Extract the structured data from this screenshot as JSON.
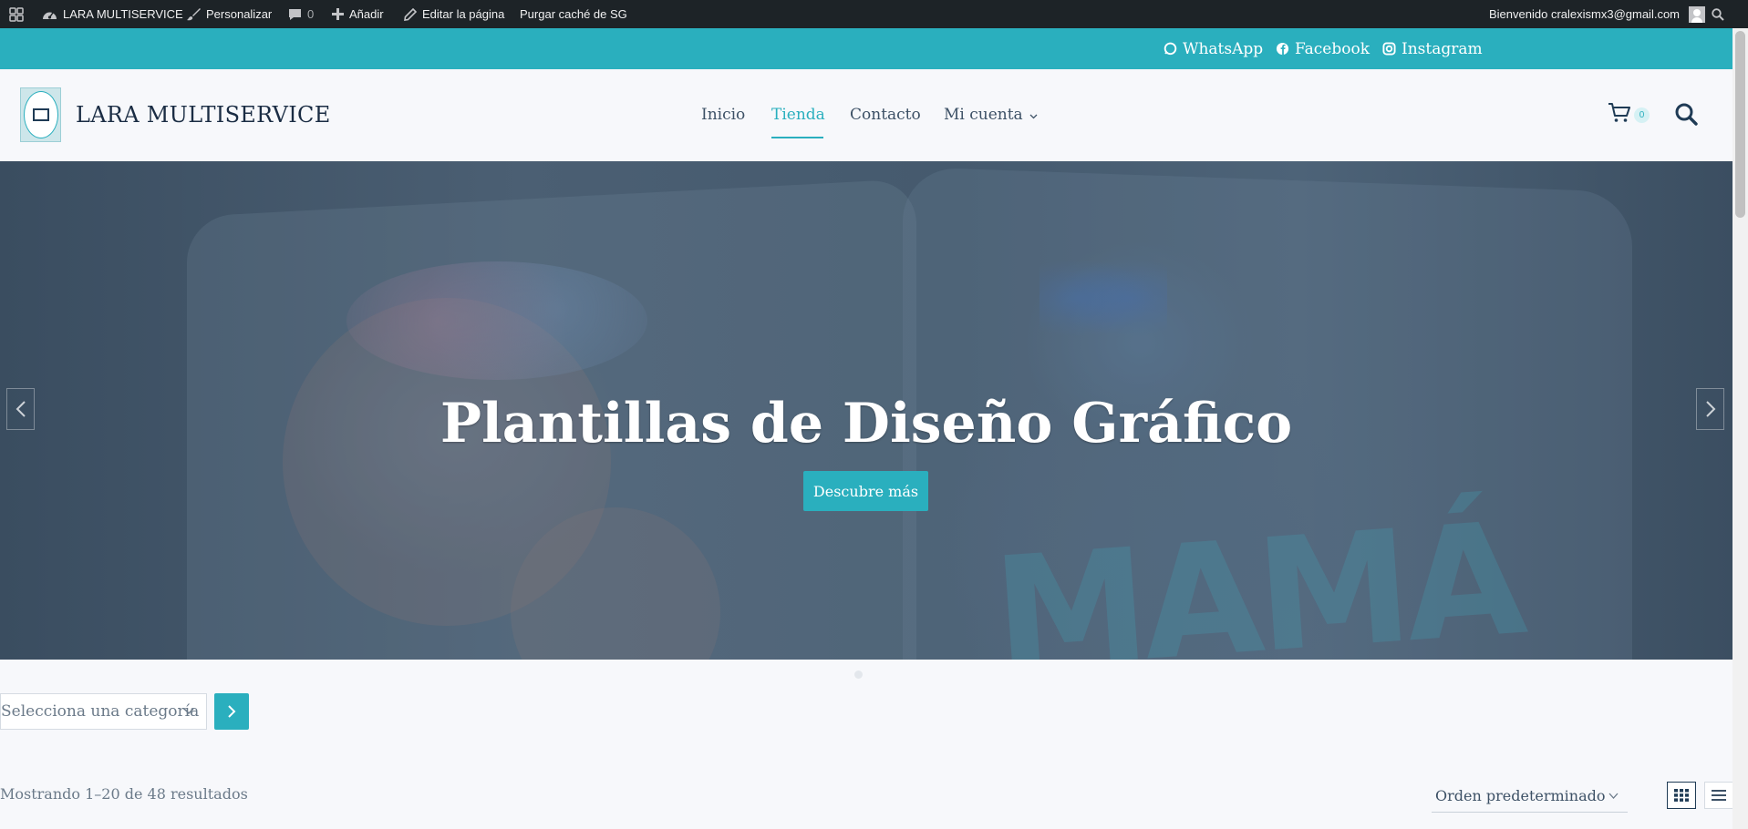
{
  "admin_bar": {
    "site_name": "LARA MULTISERVICE",
    "customize": "Personalizar",
    "comments_count": "0",
    "add_new": "Añadir",
    "edit_page": "Editar la página",
    "purge_cache": "Purgar caché de SG",
    "welcome": "Bienvenido cralexismx3@gmail.com"
  },
  "social": [
    {
      "label": "WhatsApp",
      "icon": "whatsapp-icon"
    },
    {
      "label": "Facebook",
      "icon": "facebook-icon"
    },
    {
      "label": "Instagram",
      "icon": "instagram-icon"
    }
  ],
  "header": {
    "site_title": "LARA MULTISERVICE",
    "nav": [
      {
        "label": "Inicio",
        "active": false
      },
      {
        "label": "Tienda",
        "active": true
      },
      {
        "label": "Contacto",
        "active": false
      },
      {
        "label": "Mi cuenta",
        "active": false,
        "has_dropdown": true
      }
    ],
    "cart_count": "0"
  },
  "hero": {
    "title": "Plantillas de Diseño Gráfico",
    "button": "Descubre más",
    "background_text": "MAMÁ"
  },
  "shop": {
    "category_placeholder": "Selecciona una categoría",
    "results_text": "Mostrando 1–20 de 48 resultados",
    "orderby": "Orden predeterminado"
  },
  "colors": {
    "accent": "#2aafbe",
    "admin_bar": "#1d2327",
    "heading": "#1b2d44"
  }
}
